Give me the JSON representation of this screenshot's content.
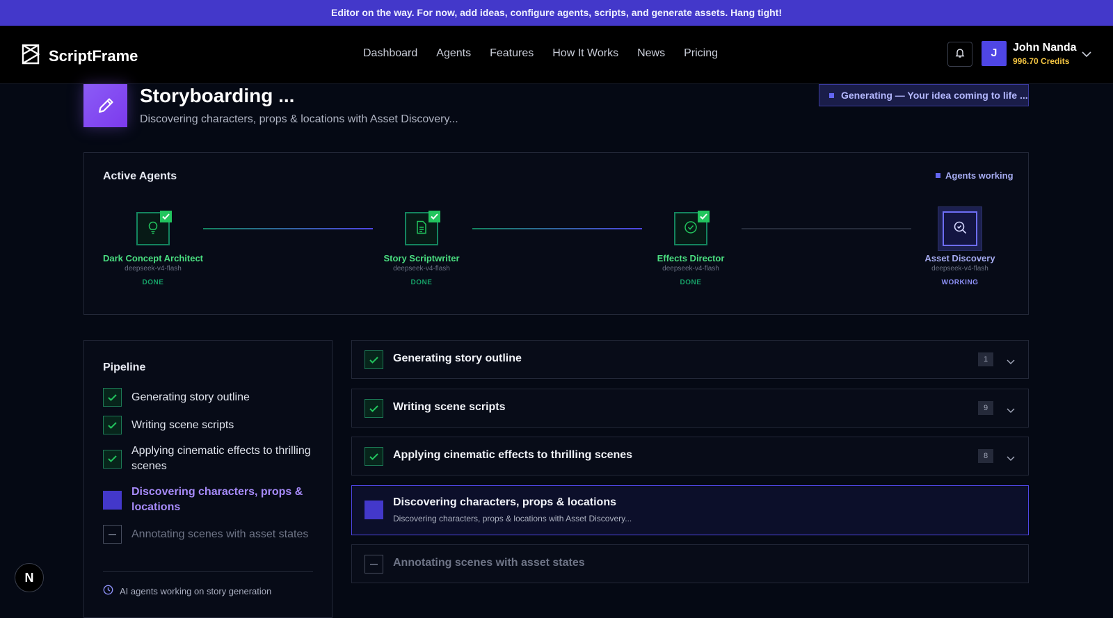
{
  "banner": {
    "text": "Editor on the way. For now, add ideas, configure agents, scripts, and generate assets. Hang tight!"
  },
  "nav": {
    "brand": "ScriptFrame",
    "links": [
      "Dashboard",
      "Agents",
      "Features",
      "How It Works",
      "News",
      "Pricing"
    ],
    "user": {
      "initial": "J",
      "name": "John Nanda",
      "credits": "996.70 Credits"
    }
  },
  "header": {
    "title": "Storyboarding ...",
    "subtitle": "Discovering characters, props & locations with Asset Discovery...",
    "status_badge": "Generating — Your idea coming to life ..."
  },
  "agents_panel": {
    "title": "Active Agents",
    "status": "Agents working",
    "agents": [
      {
        "name": "Dark Concept Architect",
        "model": "deepseek-v4-flash",
        "state": "DONE",
        "icon": "lightbulb-icon"
      },
      {
        "name": "Story Scriptwriter",
        "model": "deepseek-v4-flash",
        "state": "DONE",
        "icon": "document-icon"
      },
      {
        "name": "Effects Director",
        "model": "deepseek-v4-flash",
        "state": "DONE",
        "icon": "check-circle-icon"
      },
      {
        "name": "Asset Discovery",
        "model": "deepseek-v4-flash",
        "state": "WORKING",
        "icon": "search-icon"
      }
    ]
  },
  "pipeline": {
    "title": "Pipeline",
    "items": [
      {
        "label": "Generating story outline",
        "status": "done"
      },
      {
        "label": "Writing scene scripts",
        "status": "done"
      },
      {
        "label": "Applying cinematic effects to thrilling scenes",
        "status": "done"
      },
      {
        "label": "Discovering characters, props & locations",
        "status": "active"
      },
      {
        "label": "Annotating scenes with asset states",
        "status": "pending"
      }
    ],
    "footer": "AI agents working on story generation"
  },
  "steps": [
    {
      "label": "Generating story outline",
      "count": "1",
      "status": "done"
    },
    {
      "label": "Writing scene scripts",
      "count": "9",
      "status": "done"
    },
    {
      "label": "Applying cinematic effects to thrilling scenes",
      "count": "8",
      "status": "done"
    },
    {
      "label": "Discovering characters, props & locations",
      "subtitle": "Discovering characters, props & locations with Asset Discovery...",
      "status": "active"
    },
    {
      "label": "Annotating scenes with asset states",
      "status": "pending"
    }
  ],
  "fab": {
    "label": "N"
  },
  "colors": {
    "accent": "#4f46e5",
    "done": "#22c55e",
    "credits": "#f4c542",
    "banner": "#4338ca"
  }
}
